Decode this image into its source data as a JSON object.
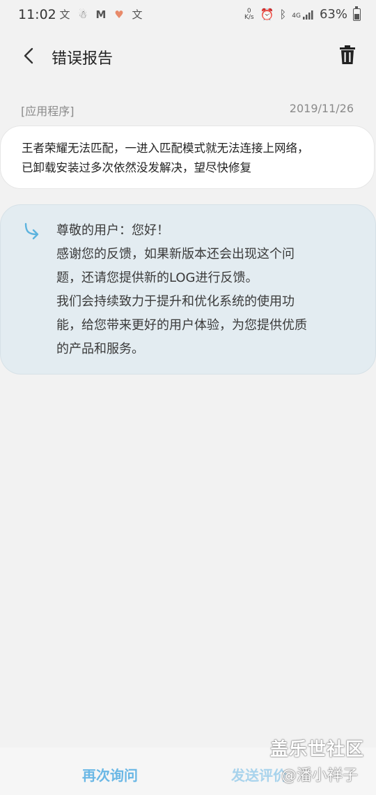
{
  "status_bar": {
    "time": "11:02",
    "left_icons": [
      "translate-icon",
      "wechat-icon",
      "gmail-icon",
      "health-icon",
      "translate-icon"
    ],
    "net_speed_value": "0",
    "net_speed_unit": "K/s",
    "signal_label": "4G",
    "battery_percent": "63%",
    "battery_level": 0.63
  },
  "app_bar": {
    "title": "错误报告"
  },
  "report": {
    "category": "[应用程序]",
    "date": "2019/11/26",
    "message_line1": "王者荣耀无法匹配，一进入匹配模式就无法连接上网络，",
    "message_line2": "已卸载安装过多次依然没发解决，望尽快修复"
  },
  "reply": {
    "lines": [
      "尊敬的用户：您好！",
      "感谢您的反馈，如果新版本还会出现这个问",
      "题，还请您提供新的LOG进行反馈。",
      "我们会持续致力于提升和优化系统的使用功",
      "能，给您带来更好的用户体验，为您提供优质",
      "的产品和服务。"
    ]
  },
  "bottom": {
    "reask_label": "再次询问",
    "rate_label": "发送评价"
  },
  "watermark": {
    "brand": "盖乐世社区",
    "user": "@潘小祥子"
  },
  "colors": {
    "accent": "#69b7e5",
    "reply_bg": "#e3ecf1",
    "page_bg": "#f2f2f2"
  }
}
